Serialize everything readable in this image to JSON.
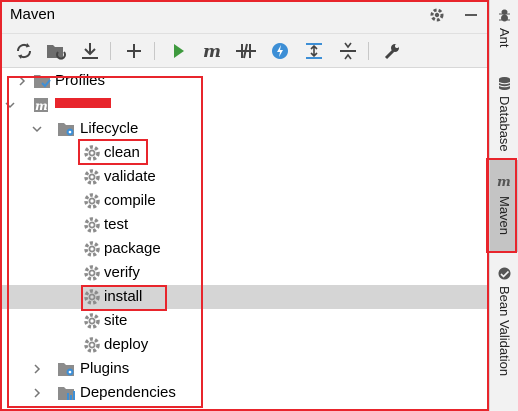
{
  "header": {
    "title": "Maven"
  },
  "toolbar": {
    "buttons": [
      {
        "name": "reload-icon",
        "tooltip": "Reload"
      },
      {
        "name": "generate-sources-icon",
        "tooltip": "Generate Sources"
      },
      {
        "name": "download-icon",
        "tooltip": "Download"
      },
      {
        "name": "add-icon",
        "tooltip": "Add"
      },
      {
        "name": "run-icon",
        "tooltip": "Run"
      },
      {
        "name": "execute-goal-icon",
        "tooltip": "Execute Maven Goal"
      },
      {
        "name": "toggle-offline-icon",
        "tooltip": "Toggle Offline"
      },
      {
        "name": "skip-tests-icon",
        "tooltip": "Skip Tests"
      },
      {
        "name": "show-dependencies-icon",
        "tooltip": "Show Dependencies"
      },
      {
        "name": "collapse-all-icon",
        "tooltip": "Collapse All"
      },
      {
        "name": "settings-wrench-icon",
        "tooltip": "Settings"
      }
    ]
  },
  "tree": {
    "profiles": "Profiles",
    "project": "",
    "lifecycle": "Lifecycle",
    "phases": [
      "clean",
      "validate",
      "compile",
      "test",
      "package",
      "verify",
      "install",
      "site",
      "deploy"
    ],
    "selected_phase": "install",
    "plugins": "Plugins",
    "dependencies": "Dependencies"
  },
  "side_tabs": [
    "Ant",
    "Database",
    "Maven",
    "Bean Validation"
  ],
  "active_side_tab": "Maven",
  "colors": {
    "annotation": "#e8252c",
    "selection": "#d5d5d5",
    "run": "#3e9a3e"
  }
}
